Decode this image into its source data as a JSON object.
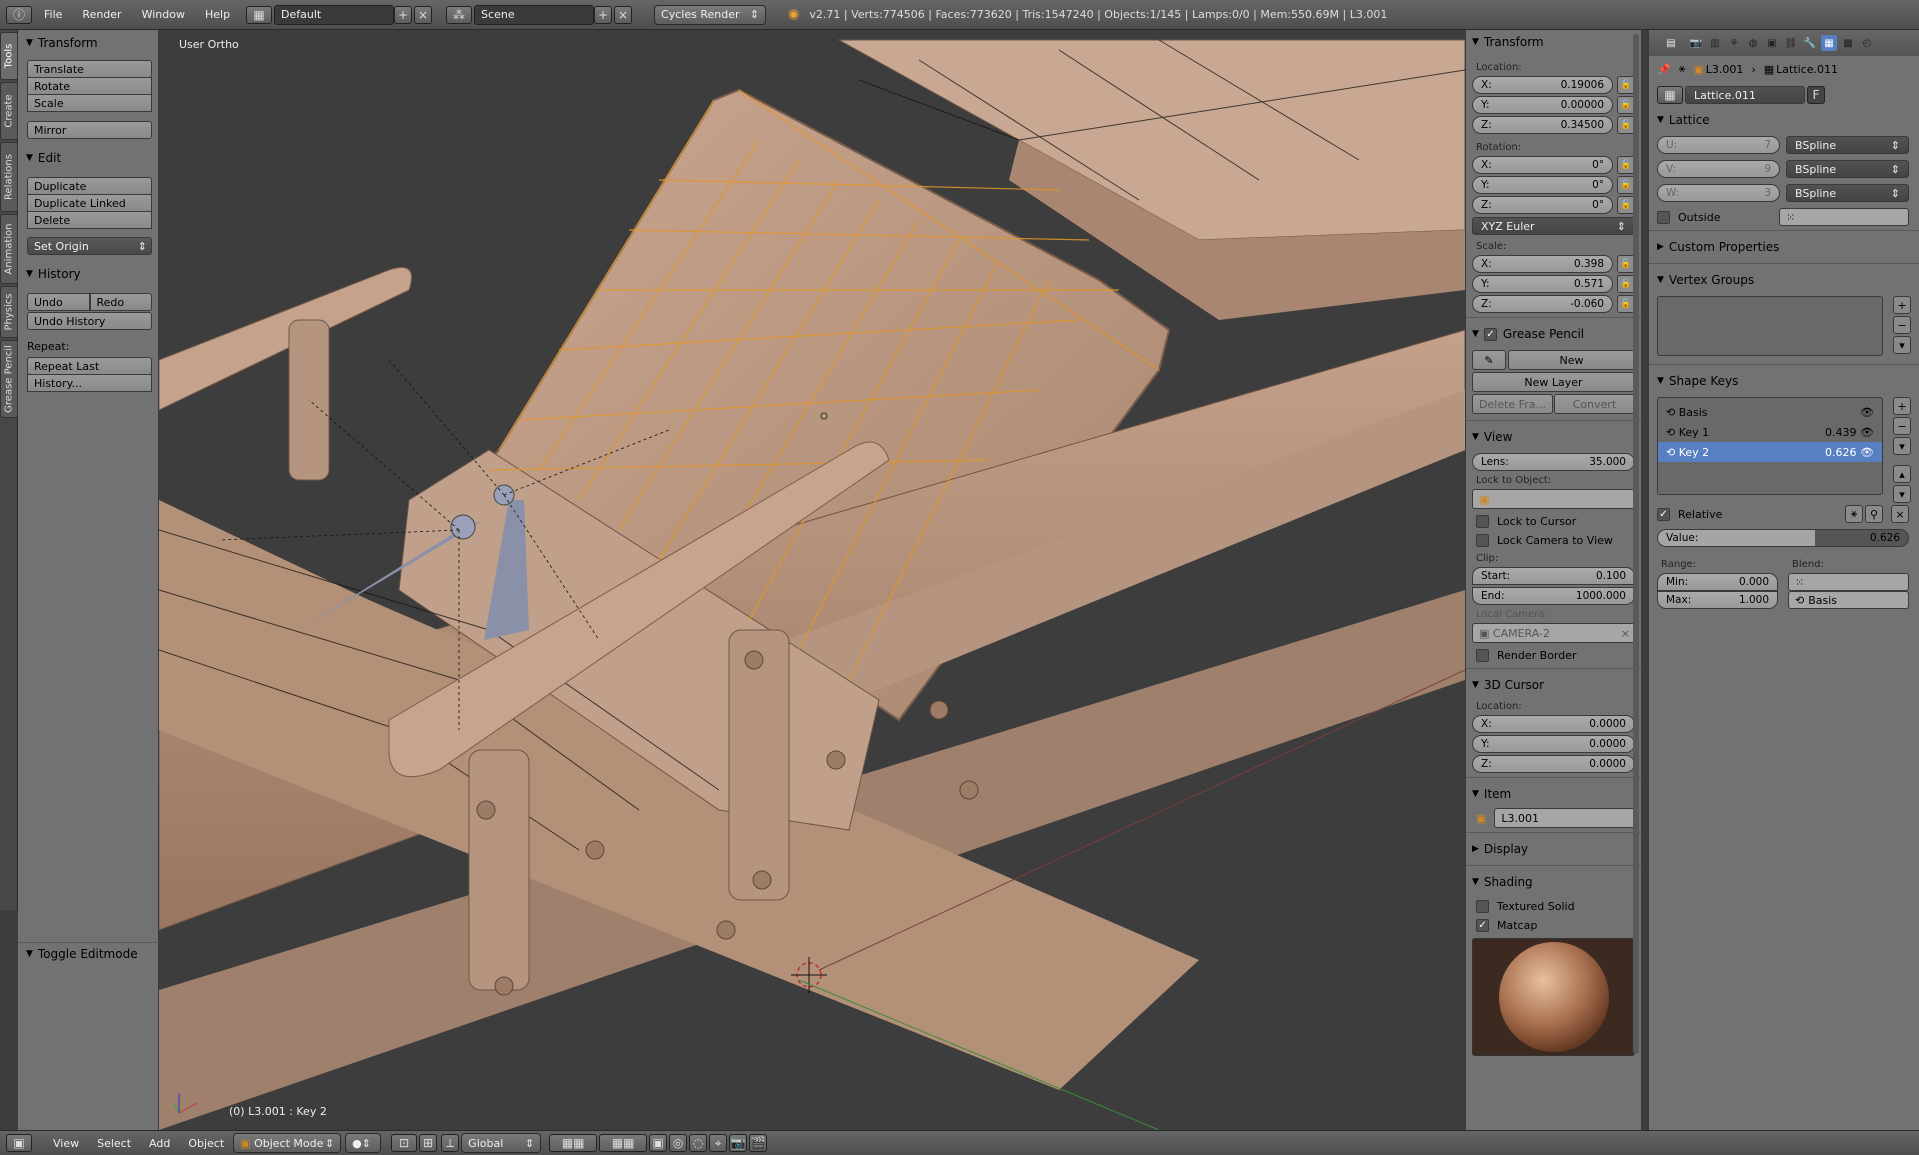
{
  "topbar": {
    "menus": [
      "File",
      "Render",
      "Window",
      "Help"
    ],
    "layout": "Default",
    "scene": "Scene",
    "engine": "Cycles Render",
    "stats": "v2.71 | Verts:774506 | Faces:773620 | Tris:1547240 | Objects:1/145 | Lamps:0/0 | Mem:550.69M | L3.001"
  },
  "vtabs": [
    "Tools",
    "Create",
    "Relations",
    "Animation",
    "Physics",
    "Grease Pencil"
  ],
  "toolshelf": {
    "transform": {
      "title": "Transform",
      "buttons": [
        "Translate",
        "Rotate",
        "Scale"
      ],
      "mirror": "Mirror"
    },
    "edit": {
      "title": "Edit",
      "buttons": [
        "Duplicate",
        "Duplicate Linked",
        "Delete"
      ],
      "set_origin": "Set Origin"
    },
    "history": {
      "title": "History",
      "undo": "Undo",
      "redo": "Redo",
      "undo_history": "Undo History",
      "repeat_label": "Repeat:",
      "repeat_last": "Repeat Last",
      "history_btn": "History..."
    },
    "toggle_editmode": "Toggle Editmode"
  },
  "viewport": {
    "title": "User Ortho",
    "status": "(0) L3.001 : Key 2"
  },
  "npanel": {
    "transform": {
      "title": "Transform",
      "location_label": "Location:",
      "location": [
        {
          "axis": "X:",
          "value": "0.19006"
        },
        {
          "axis": "Y:",
          "value": "0.00000"
        },
        {
          "axis": "Z:",
          "value": "0.34500"
        }
      ],
      "rotation_label": "Rotation:",
      "rotation": [
        {
          "axis": "X:",
          "value": "0°"
        },
        {
          "axis": "Y:",
          "value": "0°"
        },
        {
          "axis": "Z:",
          "value": "0°"
        }
      ],
      "rotation_mode": "XYZ Euler",
      "scale_label": "Scale:",
      "scale": [
        {
          "axis": "X:",
          "value": "0.398"
        },
        {
          "axis": "Y:",
          "value": "0.571"
        },
        {
          "axis": "Z:",
          "value": "-0.060"
        }
      ]
    },
    "grease_pencil": {
      "title": "Grease Pencil",
      "new": "New",
      "new_layer": "New Layer",
      "delete_frame": "Delete Fra...",
      "convert": "Convert"
    },
    "view": {
      "title": "View",
      "lens_label": "Lens:",
      "lens_value": "35.000",
      "lock_to_object": "Lock to Object:",
      "lock_to_cursor": "Lock to Cursor",
      "lock_camera": "Lock Camera to View",
      "clip_label": "Clip:",
      "clip_start_label": "Start:",
      "clip_start": "0.100",
      "clip_end_label": "End:",
      "clip_end": "1000.000",
      "local_camera": "Local Camera:",
      "camera": "CAMERA-2",
      "render_border": "Render Border"
    },
    "cursor": {
      "title": "3D Cursor",
      "location_label": "Location:",
      "location": [
        {
          "axis": "X:",
          "value": "0.0000"
        },
        {
          "axis": "Y:",
          "value": "0.0000"
        },
        {
          "axis": "Z:",
          "value": "0.0000"
        }
      ]
    },
    "item": {
      "title": "Item",
      "name": "L3.001"
    },
    "display": {
      "title": "Display"
    },
    "shading": {
      "title": "Shading",
      "textured_solid": "Textured Solid",
      "matcap": "Matcap"
    }
  },
  "props": {
    "crumbs": [
      "L3.001",
      "Lattice.011"
    ],
    "datablock": "Lattice.011",
    "datablock_flag": "F",
    "lattice": {
      "title": "Lattice",
      "rows": [
        {
          "label": "U:",
          "value": "7",
          "interp": "BSpline"
        },
        {
          "label": "V:",
          "value": "9",
          "interp": "BSpline"
        },
        {
          "label": "W:",
          "value": "3",
          "interp": "BSpline"
        }
      ],
      "outside": "Outside"
    },
    "custom_props": "Custom Properties",
    "vertex_groups": "Vertex Groups",
    "shape_keys": {
      "title": "Shape Keys",
      "keys": [
        {
          "name": "Basis",
          "value": ""
        },
        {
          "name": "Key 1",
          "value": "0.439"
        },
        {
          "name": "Key 2",
          "value": "0.626"
        }
      ],
      "relative": "Relative",
      "value_label": "Value:",
      "value": "0.626",
      "value_fraction": 0.626,
      "range_label": "Range:",
      "blend_label": "Blend:",
      "min_label": "Min:",
      "min": "0.000",
      "max_label": "Max:",
      "max": "1.000",
      "blend_value": "Basis"
    }
  },
  "bottombar": {
    "menus": [
      "View",
      "Select",
      "Add",
      "Object"
    ],
    "mode": "Object Mode",
    "orientation": "Global"
  }
}
